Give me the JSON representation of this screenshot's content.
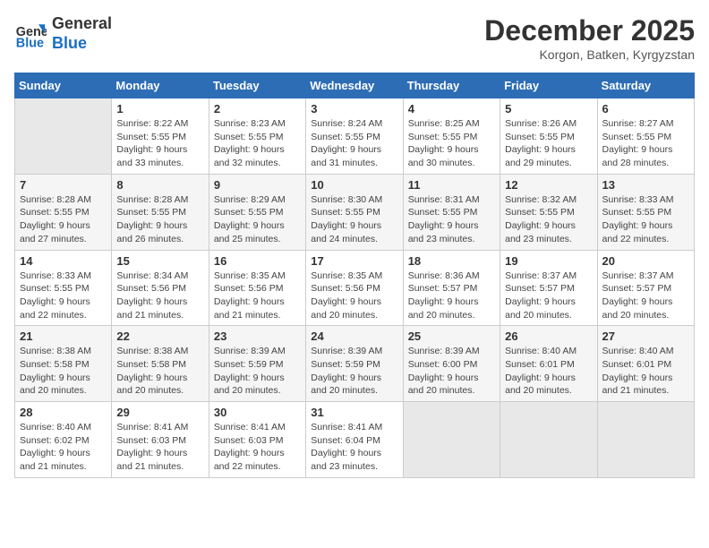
{
  "header": {
    "logo_line1": "General",
    "logo_line2": "Blue",
    "month_year": "December 2025",
    "location": "Korgon, Batken, Kyrgyzstan"
  },
  "days_of_week": [
    "Sunday",
    "Monday",
    "Tuesday",
    "Wednesday",
    "Thursday",
    "Friday",
    "Saturday"
  ],
  "weeks": [
    [
      {
        "day": "",
        "info": ""
      },
      {
        "day": "1",
        "info": "Sunrise: 8:22 AM\nSunset: 5:55 PM\nDaylight: 9 hours\nand 33 minutes."
      },
      {
        "day": "2",
        "info": "Sunrise: 8:23 AM\nSunset: 5:55 PM\nDaylight: 9 hours\nand 32 minutes."
      },
      {
        "day": "3",
        "info": "Sunrise: 8:24 AM\nSunset: 5:55 PM\nDaylight: 9 hours\nand 31 minutes."
      },
      {
        "day": "4",
        "info": "Sunrise: 8:25 AM\nSunset: 5:55 PM\nDaylight: 9 hours\nand 30 minutes."
      },
      {
        "day": "5",
        "info": "Sunrise: 8:26 AM\nSunset: 5:55 PM\nDaylight: 9 hours\nand 29 minutes."
      },
      {
        "day": "6",
        "info": "Sunrise: 8:27 AM\nSunset: 5:55 PM\nDaylight: 9 hours\nand 28 minutes."
      }
    ],
    [
      {
        "day": "7",
        "info": "Sunrise: 8:28 AM\nSunset: 5:55 PM\nDaylight: 9 hours\nand 27 minutes."
      },
      {
        "day": "8",
        "info": "Sunrise: 8:28 AM\nSunset: 5:55 PM\nDaylight: 9 hours\nand 26 minutes."
      },
      {
        "day": "9",
        "info": "Sunrise: 8:29 AM\nSunset: 5:55 PM\nDaylight: 9 hours\nand 25 minutes."
      },
      {
        "day": "10",
        "info": "Sunrise: 8:30 AM\nSunset: 5:55 PM\nDaylight: 9 hours\nand 24 minutes."
      },
      {
        "day": "11",
        "info": "Sunrise: 8:31 AM\nSunset: 5:55 PM\nDaylight: 9 hours\nand 23 minutes."
      },
      {
        "day": "12",
        "info": "Sunrise: 8:32 AM\nSunset: 5:55 PM\nDaylight: 9 hours\nand 23 minutes."
      },
      {
        "day": "13",
        "info": "Sunrise: 8:33 AM\nSunset: 5:55 PM\nDaylight: 9 hours\nand 22 minutes."
      }
    ],
    [
      {
        "day": "14",
        "info": "Sunrise: 8:33 AM\nSunset: 5:55 PM\nDaylight: 9 hours\nand 22 minutes."
      },
      {
        "day": "15",
        "info": "Sunrise: 8:34 AM\nSunset: 5:56 PM\nDaylight: 9 hours\nand 21 minutes."
      },
      {
        "day": "16",
        "info": "Sunrise: 8:35 AM\nSunset: 5:56 PM\nDaylight: 9 hours\nand 21 minutes."
      },
      {
        "day": "17",
        "info": "Sunrise: 8:35 AM\nSunset: 5:56 PM\nDaylight: 9 hours\nand 20 minutes."
      },
      {
        "day": "18",
        "info": "Sunrise: 8:36 AM\nSunset: 5:57 PM\nDaylight: 9 hours\nand 20 minutes."
      },
      {
        "day": "19",
        "info": "Sunrise: 8:37 AM\nSunset: 5:57 PM\nDaylight: 9 hours\nand 20 minutes."
      },
      {
        "day": "20",
        "info": "Sunrise: 8:37 AM\nSunset: 5:57 PM\nDaylight: 9 hours\nand 20 minutes."
      }
    ],
    [
      {
        "day": "21",
        "info": "Sunrise: 8:38 AM\nSunset: 5:58 PM\nDaylight: 9 hours\nand 20 minutes."
      },
      {
        "day": "22",
        "info": "Sunrise: 8:38 AM\nSunset: 5:58 PM\nDaylight: 9 hours\nand 20 minutes."
      },
      {
        "day": "23",
        "info": "Sunrise: 8:39 AM\nSunset: 5:59 PM\nDaylight: 9 hours\nand 20 minutes."
      },
      {
        "day": "24",
        "info": "Sunrise: 8:39 AM\nSunset: 5:59 PM\nDaylight: 9 hours\nand 20 minutes."
      },
      {
        "day": "25",
        "info": "Sunrise: 8:39 AM\nSunset: 6:00 PM\nDaylight: 9 hours\nand 20 minutes."
      },
      {
        "day": "26",
        "info": "Sunrise: 8:40 AM\nSunset: 6:01 PM\nDaylight: 9 hours\nand 20 minutes."
      },
      {
        "day": "27",
        "info": "Sunrise: 8:40 AM\nSunset: 6:01 PM\nDaylight: 9 hours\nand 21 minutes."
      }
    ],
    [
      {
        "day": "28",
        "info": "Sunrise: 8:40 AM\nSunset: 6:02 PM\nDaylight: 9 hours\nand 21 minutes."
      },
      {
        "day": "29",
        "info": "Sunrise: 8:41 AM\nSunset: 6:03 PM\nDaylight: 9 hours\nand 21 minutes."
      },
      {
        "day": "30",
        "info": "Sunrise: 8:41 AM\nSunset: 6:03 PM\nDaylight: 9 hours\nand 22 minutes."
      },
      {
        "day": "31",
        "info": "Sunrise: 8:41 AM\nSunset: 6:04 PM\nDaylight: 9 hours\nand 23 minutes."
      },
      {
        "day": "",
        "info": ""
      },
      {
        "day": "",
        "info": ""
      },
      {
        "day": "",
        "info": ""
      }
    ]
  ]
}
